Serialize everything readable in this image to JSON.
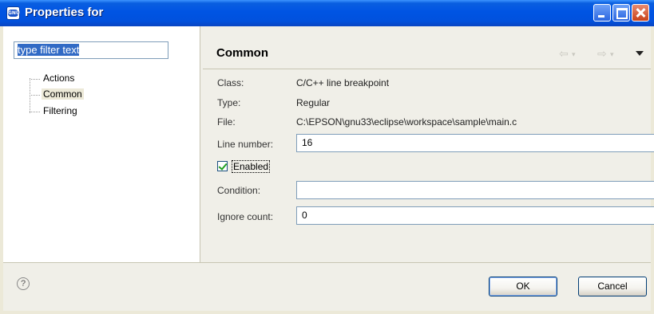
{
  "window": {
    "title": "Properties for"
  },
  "sidebar": {
    "filter_value": "type filter text",
    "items": [
      {
        "label": "Actions"
      },
      {
        "label": "Common"
      },
      {
        "label": "Filtering"
      }
    ],
    "selected": "Common"
  },
  "page": {
    "title": "Common",
    "class_label": "Class:",
    "class_value": "C/C++ line breakpoint",
    "type_label": "Type:",
    "type_value": "Regular",
    "file_label": "File:",
    "file_value": "C:\\EPSON\\gnu33\\eclipse\\workspace\\sample\\main.c",
    "line_label": "Line number:",
    "line_value": "16",
    "enabled_label": "Enabled",
    "enabled": true,
    "condition_label": "Condition:",
    "condition_value": "",
    "ignore_label": "Ignore count:",
    "ignore_value": "0"
  },
  "footer": {
    "ok_label": "OK",
    "cancel_label": "Cancel",
    "help_glyph": "?"
  },
  "icons": [
    "app-icon",
    "back-arrow-icon",
    "forward-arrow-icon",
    "view-menu-icon",
    "help-icon",
    "checkbox-check-icon"
  ]
}
